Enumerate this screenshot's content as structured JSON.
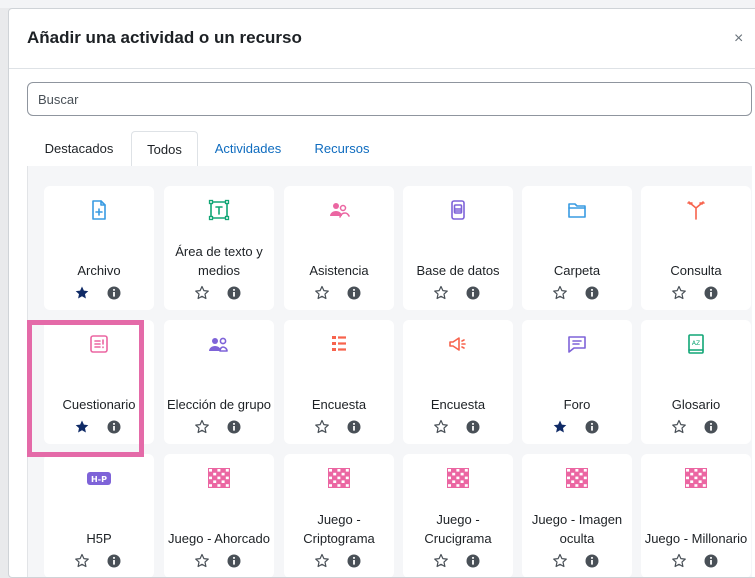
{
  "modal": {
    "title": "Añadir una actividad o un recurso",
    "close_glyph": "×",
    "search_placeholder": "Buscar"
  },
  "tabs": [
    {
      "label": "Destacados",
      "state": "default"
    },
    {
      "label": "Todos",
      "state": "active"
    },
    {
      "label": "Actividades",
      "state": "link"
    },
    {
      "label": "Recursos",
      "state": "link"
    }
  ],
  "colors": {
    "accent_link": "#0f6cbf",
    "star_filled": "#0f2a66",
    "highlight": "#e46aa8",
    "icon_blue": "#399be2",
    "icon_pink": "#eb66a2",
    "icon_purple": "#7e63d8",
    "icon_orange": "#f7634d",
    "icon_teal": "#11a676"
  },
  "activities": [
    {
      "name": "Archivo",
      "icon": "file-plus-icon",
      "color": "#399be2",
      "starred": true
    },
    {
      "name": "Área de texto y medios",
      "icon": "text-area-icon",
      "color": "#11a676",
      "starred": false
    },
    {
      "name": "Asistencia",
      "icon": "attendance-icon",
      "color": "#eb66a2",
      "starred": false
    },
    {
      "name": "Base de datos",
      "icon": "database-icon",
      "color": "#7e63d8",
      "starred": false
    },
    {
      "name": "Carpeta",
      "icon": "folder-icon",
      "color": "#399be2",
      "starred": false
    },
    {
      "name": "Consulta",
      "icon": "choice-icon",
      "color": "#f7634d",
      "starred": false
    },
    {
      "name": "Cuestionario",
      "icon": "quiz-icon",
      "color": "#eb66a2",
      "starred": true
    },
    {
      "name": "Elección de grupo",
      "icon": "group-choice-icon",
      "color": "#7e63d8",
      "starred": false
    },
    {
      "name": "Encuesta",
      "icon": "survey-list-icon",
      "color": "#f7634d",
      "starred": false
    },
    {
      "name": "Encuesta",
      "icon": "megaphone-icon",
      "color": "#f7634d",
      "starred": false
    },
    {
      "name": "Foro",
      "icon": "forum-icon",
      "color": "#7e63d8",
      "starred": true
    },
    {
      "name": "Glosario",
      "icon": "glossary-icon",
      "color": "#11a676",
      "starred": false
    },
    {
      "name": "H5P",
      "icon": "h5p-icon",
      "color": "#7e63d8",
      "starred": false
    },
    {
      "name": "Juego - Ahorcado",
      "icon": "game-grid-icon",
      "color": "#eb66a2",
      "starred": false
    },
    {
      "name": "Juego - Criptograma",
      "icon": "game-grid-icon",
      "color": "#eb66a2",
      "starred": false
    },
    {
      "name": "Juego - Crucigrama",
      "icon": "game-grid-icon",
      "color": "#eb66a2",
      "starred": false
    },
    {
      "name": "Juego - Imagen oculta",
      "icon": "game-grid-icon",
      "color": "#eb66a2",
      "starred": false
    },
    {
      "name": "Juego - Millonario",
      "icon": "game-grid-icon",
      "color": "#eb66a2",
      "starred": false
    }
  ],
  "highlighted_item": "Cuestionario"
}
